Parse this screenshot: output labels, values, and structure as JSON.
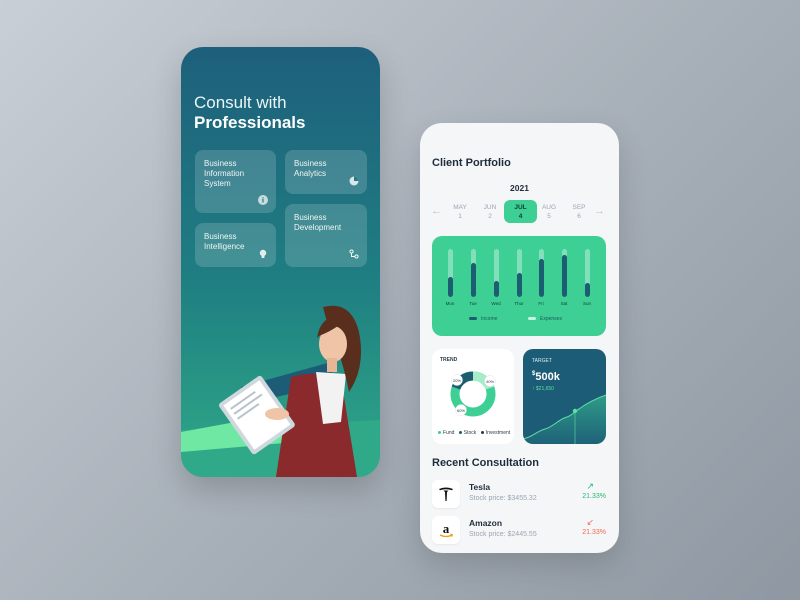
{
  "left_screen": {
    "headline_line1": "Consult with",
    "headline_line2": "Professionals",
    "services": [
      {
        "label": "Business Information System",
        "icon": "info-icon"
      },
      {
        "label": "Business Analytics",
        "icon": "pie-chart-icon"
      },
      {
        "label": "Business Intelligence",
        "icon": "lightbulb-icon"
      },
      {
        "label": "Business Development",
        "icon": "nodes-icon"
      }
    ],
    "illustration": "person-holding-clipboard"
  },
  "right_screen": {
    "title": "Client Portfolio",
    "year": "2021",
    "months": [
      {
        "name": "MAY",
        "day": "1",
        "active": false
      },
      {
        "name": "JUN",
        "day": "2",
        "active": false
      },
      {
        "name": "JUL",
        "day": "4",
        "active": true
      },
      {
        "name": "AUG",
        "day": "5",
        "active": false
      },
      {
        "name": "SEP",
        "day": "6",
        "active": false
      }
    ],
    "weekly_chart": {
      "days": [
        "Mon",
        "Tue",
        "Wed",
        "Thur",
        "Fri",
        "Sat",
        "Sun"
      ],
      "legend": [
        "Income",
        "Expenses"
      ],
      "colors": {
        "income": "#1c5d72",
        "expenses": "#c9f2de",
        "card": "#3ecf95"
      }
    },
    "trend": {
      "title": "TREND",
      "labels": [
        "20%",
        "40%",
        "60%"
      ],
      "legend": [
        "Fund",
        "Stock",
        "Investment"
      ],
      "colors": {
        "fund": "#3ecf95",
        "stock": "#1c5d72",
        "investment": "#a6ecc8"
      }
    },
    "target": {
      "title": "TARGET",
      "currency": "$",
      "value": "500k",
      "delta": "$21,650"
    },
    "recent_title": "Recent Consultation",
    "consultations": [
      {
        "name": "Tesla",
        "price": "Stock price: $3455.32",
        "change": "21.33%",
        "direction": "up",
        "logo": "tesla-logo",
        "arrow": "↗"
      },
      {
        "name": "Amazon",
        "price": "Stock price: $2445.55",
        "change": "21.33%",
        "direction": "down",
        "logo": "amazon-logo",
        "arrow": "↙"
      }
    ]
  }
}
